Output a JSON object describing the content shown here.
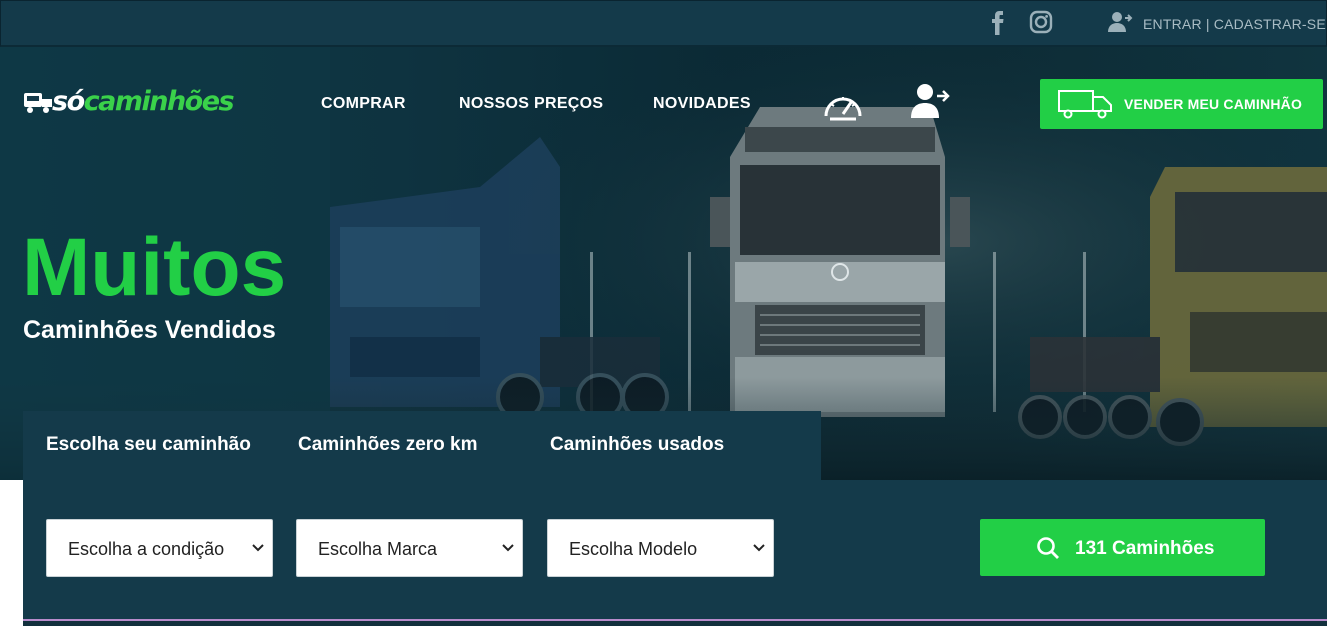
{
  "topbar": {
    "icons": [
      "facebook-icon",
      "instagram-icon",
      "user-add-icon"
    ],
    "login_text": "ENTRAR | CADASTRAR-SE"
  },
  "header": {
    "logo_so": "só",
    "logo_caminhoes": "caminhões",
    "nav": [
      "COMPRAR",
      "NOSSOS PREÇOS",
      "NOVIDADES"
    ],
    "icons": [
      "speedometer-icon",
      "user-login-icon"
    ],
    "sell_button": "VENDER MEU CAMINHÃO"
  },
  "hero": {
    "title": "Muitos",
    "subtitle": "Caminhões Vendidos"
  },
  "search": {
    "tabs": [
      "Escolha seu caminhão",
      "Caminhões zero km",
      "Caminhões usados"
    ],
    "selects": [
      "Escolha a condição",
      "Escolha Marca",
      "Escolha Modelo"
    ],
    "button_label": "131 Caminhões"
  },
  "colors": {
    "accent": "#22cf46",
    "navy": "#143a4a",
    "hero_dark": "#0b2a35"
  }
}
